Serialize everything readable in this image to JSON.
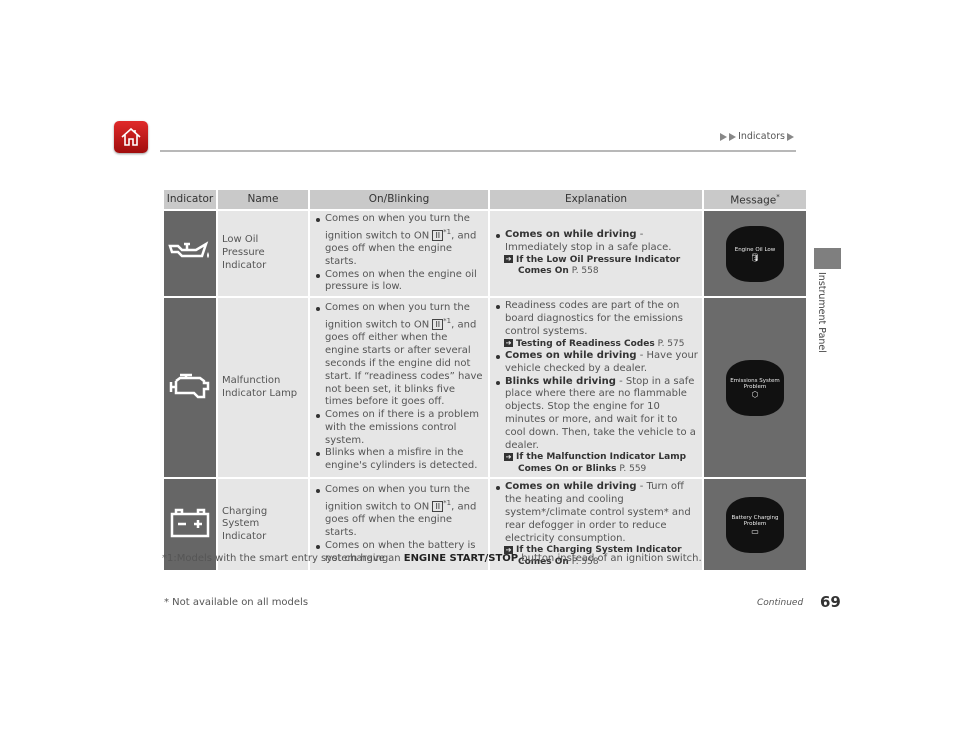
{
  "header": {
    "breadcrumb": "Indicators",
    "home_icon": "home-icon"
  },
  "sidebar": {
    "section_label": "Instrument Panel"
  },
  "table": {
    "headers": [
      "Indicator",
      "Name",
      "On/Blinking",
      "Explanation",
      "Message"
    ],
    "message_header_mark": "*",
    "rows": [
      {
        "icon": "oil-can-icon",
        "name": "Low Oil Pressure Indicator",
        "on_blinking": [
          {
            "pre": "Comes on when you turn the ignition switch to ON ",
            "key": "II",
            "post_sup": "*1",
            "post": ", and goes off when the engine starts."
          },
          {
            "pre": "Comes on when the engine oil pressure is low."
          }
        ],
        "explanation": [
          {
            "bold": "Comes on while driving",
            "text": " - Immediately stop in a safe place.",
            "ref_bold": "If the Low Oil Pressure Indicator Comes On",
            "ref_page": " P. 558"
          }
        ],
        "message": "Engine Oil Low"
      },
      {
        "icon": "engine-icon",
        "name": "Malfunction Indicator Lamp",
        "on_blinking": [
          {
            "pre": "Comes on when you turn the ignition switch to ON ",
            "key": "II",
            "post_sup": "*1",
            "post": ", and goes off either when the engine starts or after several seconds if the engine did not start. If “readiness codes” have not been set, it blinks five times before it goes off."
          },
          {
            "pre": "Comes on if there is a problem with the emissions control system."
          },
          {
            "pre": "Blinks when a misfire in the engine's cylinders is detected."
          }
        ],
        "explanation": [
          {
            "bold": "",
            "text": "Readiness codes are part of the on board diagnostics for the emissions control systems.",
            "ref_bold": "Testing of Readiness Codes",
            "ref_page": " P. 575"
          },
          {
            "bold": "Comes on while driving",
            "text": " - Have your vehicle checked by a dealer."
          },
          {
            "bold": "Blinks while driving",
            "text": " - Stop in a safe place where there are no flammable objects. Stop the engine for 10 minutes or more, and wait for it to cool down. Then, take the vehicle to a dealer.",
            "ref_bold": "If the Malfunction Indicator Lamp Comes On or Blinks",
            "ref_page": " P. 559"
          }
        ],
        "message": "Emissions System Problem"
      },
      {
        "icon": "battery-icon",
        "name": "Charging System Indicator",
        "on_blinking": [
          {
            "pre": "Comes on when you turn the ignition switch to ON ",
            "key": "II",
            "post_sup": "*1",
            "post": ", and goes off when the engine starts."
          },
          {
            "pre": "Comes on when the battery is not charging."
          }
        ],
        "explanation": [
          {
            "bold": "Comes on while driving",
            "text": " - Turn off the heating and cooling system*/climate control system* and rear defogger in order to reduce electricity consumption.",
            "ref_bold": "If the Charging System Indicator Comes On",
            "ref_page": " P. 558"
          }
        ],
        "message": "Battery Charging Problem"
      }
    ]
  },
  "footnote": {
    "pre": "*1:Models with the smart entry system have an ",
    "bold": "ENGINE START/STOP",
    "post": " button instead of an ignition switch."
  },
  "footer": {
    "not_available": "* Not available on all models",
    "continued": "Continued",
    "page_number": "69"
  }
}
